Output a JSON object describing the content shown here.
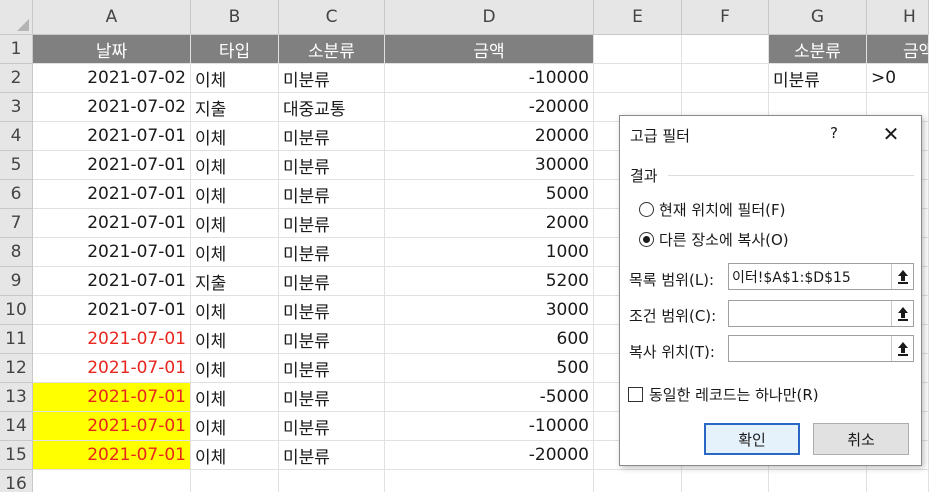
{
  "columns": [
    "A",
    "B",
    "C",
    "D",
    "E",
    "F",
    "G",
    "H"
  ],
  "header_row": {
    "number": "1",
    "date": "날짜",
    "type": "타입",
    "category": "소분류",
    "amount": "금액",
    "crit_header_g": "소분류",
    "crit_header_h": "금액"
  },
  "criteria_row": {
    "number": "2",
    "g": "미분류",
    "h": ">0"
  },
  "rows": [
    {
      "n": "2",
      "date": "2021-07-02",
      "type": "이체",
      "cat": "미분류",
      "amt": "-10000"
    },
    {
      "n": "3",
      "date": "2021-07-02",
      "type": "지출",
      "cat": "대중교통",
      "amt": "-20000"
    },
    {
      "n": "4",
      "date": "2021-07-01",
      "type": "이체",
      "cat": "미분류",
      "amt": "20000"
    },
    {
      "n": "5",
      "date": "2021-07-01",
      "type": "이체",
      "cat": "미분류",
      "amt": "30000"
    },
    {
      "n": "6",
      "date": "2021-07-01",
      "type": "이체",
      "cat": "미분류",
      "amt": "5000"
    },
    {
      "n": "7",
      "date": "2021-07-01",
      "type": "이체",
      "cat": "미분류",
      "amt": "2000"
    },
    {
      "n": "8",
      "date": "2021-07-01",
      "type": "이체",
      "cat": "미분류",
      "amt": "1000"
    },
    {
      "n": "9",
      "date": "2021-07-01",
      "type": "지출",
      "cat": "미분류",
      "amt": "5200"
    },
    {
      "n": "10",
      "date": "2021-07-01",
      "type": "이체",
      "cat": "미분류",
      "amt": "3000"
    },
    {
      "n": "11",
      "date": "2021-07-01",
      "type": "이체",
      "cat": "미분류",
      "amt": "600"
    },
    {
      "n": "12",
      "date": "2021-07-01",
      "type": "이체",
      "cat": "미분류",
      "amt": "500"
    },
    {
      "n": "13",
      "date": "2021-07-01",
      "type": "이체",
      "cat": "미분류",
      "amt": "-5000"
    },
    {
      "n": "14",
      "date": "2021-07-01",
      "type": "이체",
      "cat": "미분류",
      "amt": "-10000"
    },
    {
      "n": "15",
      "date": "2021-07-01",
      "type": "이체",
      "cat": "미분류",
      "amt": "-20000"
    }
  ],
  "last_row_number": "16",
  "colors": {
    "red_date": "#e8261e",
    "yellow_fill": "#ffff00",
    "header_fill": "#808080",
    "highlight": "#e01e24"
  },
  "dialog": {
    "title": "고급 필터",
    "help": "?",
    "close": "✕",
    "group_label": "결과",
    "radio_in_place": "현재 위치에 필터(F)",
    "radio_copy": "다른 장소에 복사(O)",
    "selected_radio": "copy",
    "list_range_label": "목록 범위(L):",
    "list_range_value": "이터!$A$1:$D$15",
    "criteria_range_label": "조건 범위(C):",
    "criteria_range_value": "",
    "copy_to_label": "복사 위치(T):",
    "copy_to_value": "",
    "unique_label": "동일한 레코드는 하나만(R)",
    "unique_checked": false,
    "ok_label": "확인",
    "cancel_label": "취소",
    "collapse_icon": "range-collapse-icon"
  }
}
